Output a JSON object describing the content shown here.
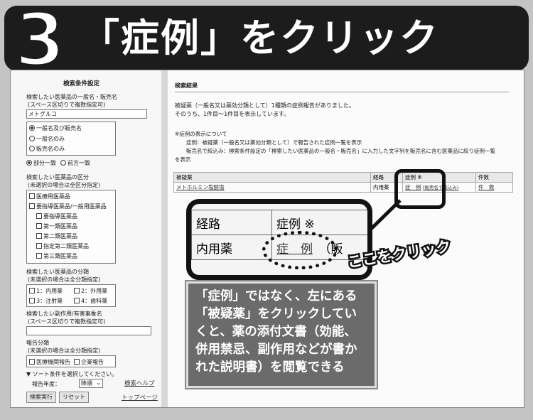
{
  "headline": {
    "step": "3",
    "title": "「症例」をクリック"
  },
  "left_panel": {
    "title": "検索条件設定",
    "drug_name_label": "検索したい医薬品の一般名・販売名",
    "drug_name_hint": "(スペース区切りで複数指定可)",
    "drug_name_value": "メトグルコ",
    "name_type_options": [
      "一般名及び販売名",
      "一般名のみ",
      "販売名のみ"
    ],
    "match_options": [
      "部分一致",
      "前方一致"
    ],
    "category_label": "検索したい医薬品の区分",
    "category_hint": "(未選択の場合は全区分指定)",
    "categories": [
      "医療用医薬品",
      "要指導医薬品/一般用医薬品",
      "要指導医薬品",
      "第一類医薬品",
      "第二類医薬品",
      "指定第二類医薬品",
      "第三類医薬品"
    ],
    "class_label": "検索したい医薬品の分類",
    "class_hint": "(未選択の場合は全分類指定)",
    "classes": [
      "1：内用薬",
      "2：外用薬",
      "3：注射薬",
      "4：歯科薬"
    ],
    "side_effect_label": "検索したい副作用/有害事象名",
    "side_effect_hint": "(スペース区切りで複数指定可)",
    "report_label": "報告分類",
    "report_hint": "(未選択の場合は全分類指定)",
    "report_types": [
      "医療機関報告",
      "企業報告"
    ],
    "sort_label": "▼ ソート条件を選択してください。",
    "sort_field_label": "報告年度：",
    "sort_order": "降順",
    "help_link": "検索ヘルプ",
    "search_button": "検索実行",
    "reset_button": "リセット",
    "top_link": "トップページ"
  },
  "results": {
    "title": "検索結果",
    "summary1": "被疑薬（一般名又は薬効分類として）1種類の症例報告がありました。",
    "summary2": "そのうち、1件目〜1件目を表示しています。",
    "note_title": "※症例の表示について",
    "note1": "症例：被疑薬（一般名又は薬効分類として）で報告された症例一覧を表示",
    "note2": "販売名で絞込み：検索条件設定の「検索したい医薬品の一般名・販売名」に入力した文字列を販売名に含む医薬品に絞り症例一覧",
    "note3": "を表示",
    "headers": [
      "被疑薬",
      "経路",
      "症例 ※",
      "件数"
    ],
    "row": {
      "drug": "メトホルミン塩酸塩",
      "route": "内用薬",
      "case_link": "症　例",
      "filter_link": "(販売名で絞込み)",
      "count_link": "件　数"
    }
  },
  "zoom": {
    "col1": "経路",
    "col2": "症例 ※",
    "route": "内用薬",
    "case_link": "症　例",
    "extra": "（販"
  },
  "callout": "ここをクリック",
  "caption": "「症例」ではなく、左にある「被疑薬」をクリックしていくと、薬の添付文書（効能、併用禁忌、副作用などが書かれた説明書）を閲覧できる"
}
